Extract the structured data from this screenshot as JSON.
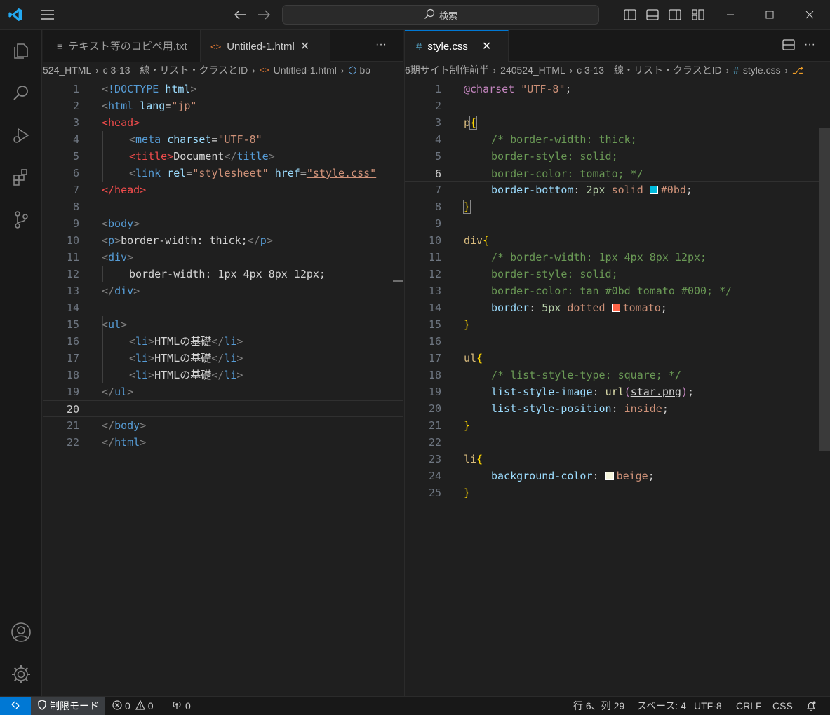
{
  "titlebar": {
    "search_label": "検索",
    "icons": [
      "vscode-logo-icon",
      "menu-icon",
      "back-arrow-icon",
      "forward-arrow-icon",
      "toggle-primary-sidebar-icon",
      "toggle-panel-icon",
      "toggle-secondary-sidebar-icon",
      "customize-layout-icon",
      "minimize-icon",
      "maximize-icon",
      "close-window-icon"
    ]
  },
  "activitybar": {
    "icons": [
      "explorer-icon",
      "search-icon",
      "run-debug-icon",
      "extensions-icon",
      "source-control-icon",
      "account-icon",
      "settings-gear-icon"
    ]
  },
  "left_group": {
    "tabs": [
      {
        "label": "テキスト等のコピペ用.txt",
        "icon": "text-file-icon"
      },
      {
        "label": "Untitled-1.html",
        "icon": "html-file-icon",
        "close": "✕"
      }
    ],
    "more": "···",
    "breadcrumb": [
      "524_HTML",
      "c 3-13　線・リスト・クラスとID",
      "Untitled-1.html",
      "bo"
    ],
    "lines": [
      "1",
      "2",
      "3",
      "4",
      "5",
      "6",
      "7",
      "8",
      "9",
      "10",
      "11",
      "12",
      "13",
      "14",
      "15",
      "16",
      "17",
      "18",
      "19",
      "20",
      "21",
      "22"
    ],
    "current_line": "20"
  },
  "right_group": {
    "tabs": [
      {
        "label": "style.css",
        "icon": "css-hash-icon",
        "close": "✕"
      }
    ],
    "more": "···",
    "breadcrumb": [
      "6期サイト制作前半",
      "240524_HTML",
      "c 3-13　線・リスト・クラスとID",
      "style.css"
    ],
    "lines": [
      "1",
      "2",
      "3",
      "4",
      "5",
      "6",
      "7",
      "8",
      "9",
      "10",
      "11",
      "12",
      "13",
      "14",
      "15",
      "16",
      "17",
      "18",
      "19",
      "20",
      "21",
      "22",
      "23",
      "24",
      "25"
    ],
    "current_line": "6"
  },
  "colors": {
    "swatch_0bd": "#00bbdd",
    "swatch_tomato": "#ff6347",
    "swatch_beige": "#f5f5dc",
    "accent": "#0078d4"
  },
  "statusbar": {
    "restricted_mode": "制限モード",
    "errors": "0",
    "warnings": "0",
    "ports": "0",
    "position": "行 6、列 29",
    "spaces": "スペース: 4",
    "encoding": "UTF-8",
    "eol": "CRLF",
    "language": "CSS"
  }
}
